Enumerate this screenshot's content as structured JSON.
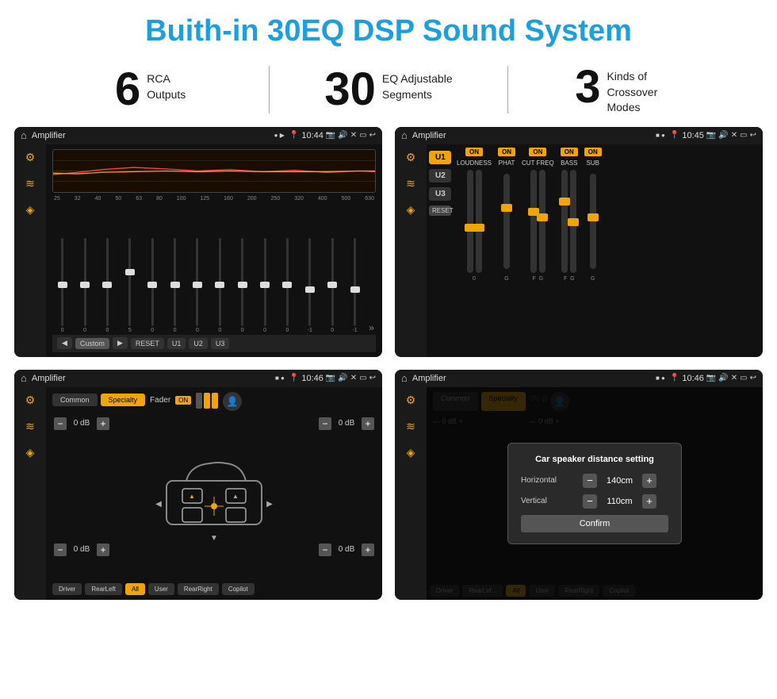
{
  "page": {
    "title": "Buith-in 30EQ DSP Sound System",
    "stats": [
      {
        "number": "6",
        "desc": "RCA\nOutputs"
      },
      {
        "number": "30",
        "desc": "EQ Adjustable\nSegments"
      },
      {
        "number": "3",
        "desc": "Kinds of\nCrossover Modes"
      }
    ]
  },
  "screens": {
    "screen1": {
      "app": "Amplifier",
      "time": "10:44",
      "eq_freqs": [
        "25",
        "32",
        "40",
        "50",
        "63",
        "80",
        "100",
        "125",
        "160",
        "200",
        "250",
        "320",
        "400",
        "500",
        "630"
      ],
      "eq_vals": [
        "0",
        "0",
        "0",
        "5",
        "0",
        "0",
        "0",
        "0",
        "0",
        "0",
        "0",
        "-1",
        "0",
        "-1"
      ],
      "preset": "Custom",
      "buttons": [
        "◀",
        "Custom",
        "▶",
        "RESET",
        "U1",
        "U2",
        "U3"
      ]
    },
    "screen2": {
      "app": "Amplifier",
      "time": "10:45",
      "channels": [
        "U1",
        "U2",
        "U3"
      ],
      "controls": [
        "LOUDNESS",
        "PHAT",
        "CUT FREQ",
        "BASS",
        "SUB"
      ],
      "reset": "RESET"
    },
    "screen3": {
      "app": "Amplifier",
      "time": "10:46",
      "tabs": [
        "Common",
        "Specialty"
      ],
      "fader_label": "Fader",
      "fader_on": "ON",
      "controls": [
        {
          "label": "— 0 dB +"
        },
        {
          "label": "— 0 dB +"
        },
        {
          "label": "— 0 dB +"
        },
        {
          "label": "— 0 dB +"
        }
      ],
      "bottom_btns": [
        "Driver",
        "RearLeft",
        "All",
        "User",
        "RearRight",
        "Copilot"
      ]
    },
    "screen4": {
      "app": "Amplifier",
      "time": "10:46",
      "dialog": {
        "title": "Car speaker distance setting",
        "horizontal_label": "Horizontal",
        "horizontal_val": "140cm",
        "vertical_label": "Vertical",
        "vertical_val": "110cm",
        "confirm": "Confirm"
      },
      "bottom_btns": [
        "Driver",
        "RearLef...",
        "All",
        "User",
        "RearRight",
        "Copilot"
      ]
    }
  },
  "colors": {
    "accent": "#1a9fe0",
    "orange": "#f0a500",
    "bg": "#ffffff",
    "screen_bg": "#111111"
  }
}
